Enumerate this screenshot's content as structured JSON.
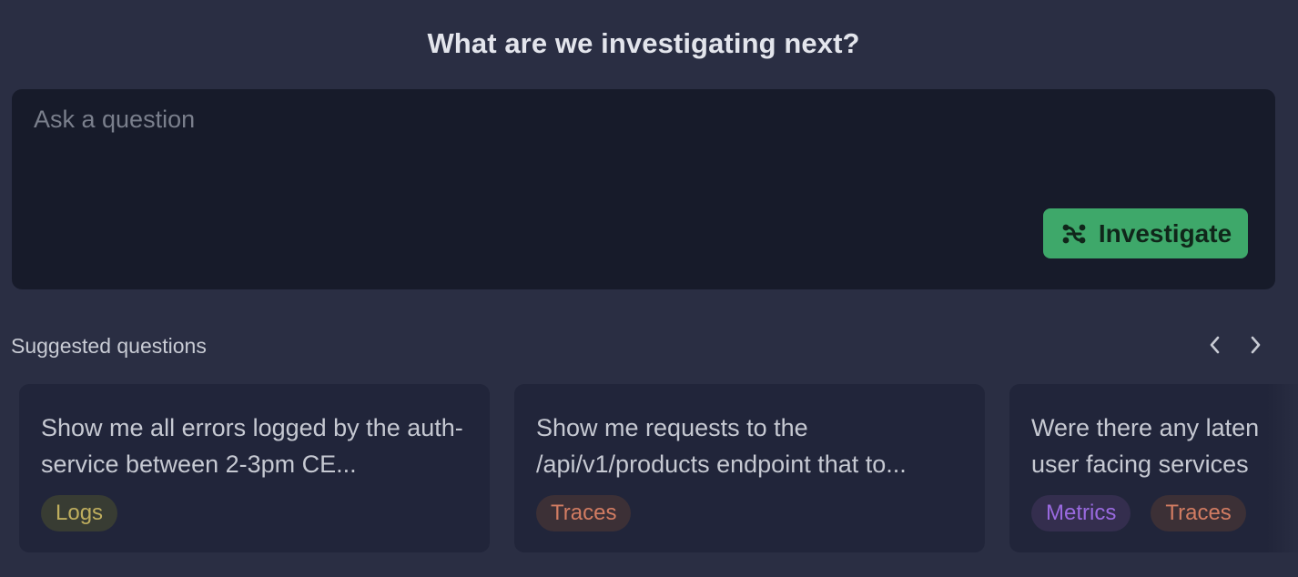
{
  "heading": "What are we investigating next?",
  "question_input": {
    "placeholder": "Ask a question",
    "value": ""
  },
  "investigate_button": {
    "label": "Investigate",
    "icon": "investigate-icon",
    "color": "#3ea86a"
  },
  "suggested": {
    "title": "Suggested questions",
    "prev_icon": "chevron-left-icon",
    "next_icon": "chevron-right-icon",
    "cards": [
      {
        "text": "Show me all errors logged by the auth-service between 2-3pm CE...",
        "tags": [
          "Logs"
        ]
      },
      {
        "text": "Show me requests to the /api/v1/products endpoint that to...",
        "tags": [
          "Traces"
        ]
      },
      {
        "text": "Were there any laten user facing services",
        "line1": "Were there any laten",
        "line2": "user facing services",
        "tags": [
          "Metrics",
          "Traces"
        ]
      }
    ]
  },
  "colors": {
    "background": "#2a2e43",
    "input_background": "#171b2a",
    "card_background": "#21253a",
    "logs_tag": "#bfae5e",
    "traces_tag": "#d27c62",
    "metrics_tag": "#9a6ae0"
  }
}
